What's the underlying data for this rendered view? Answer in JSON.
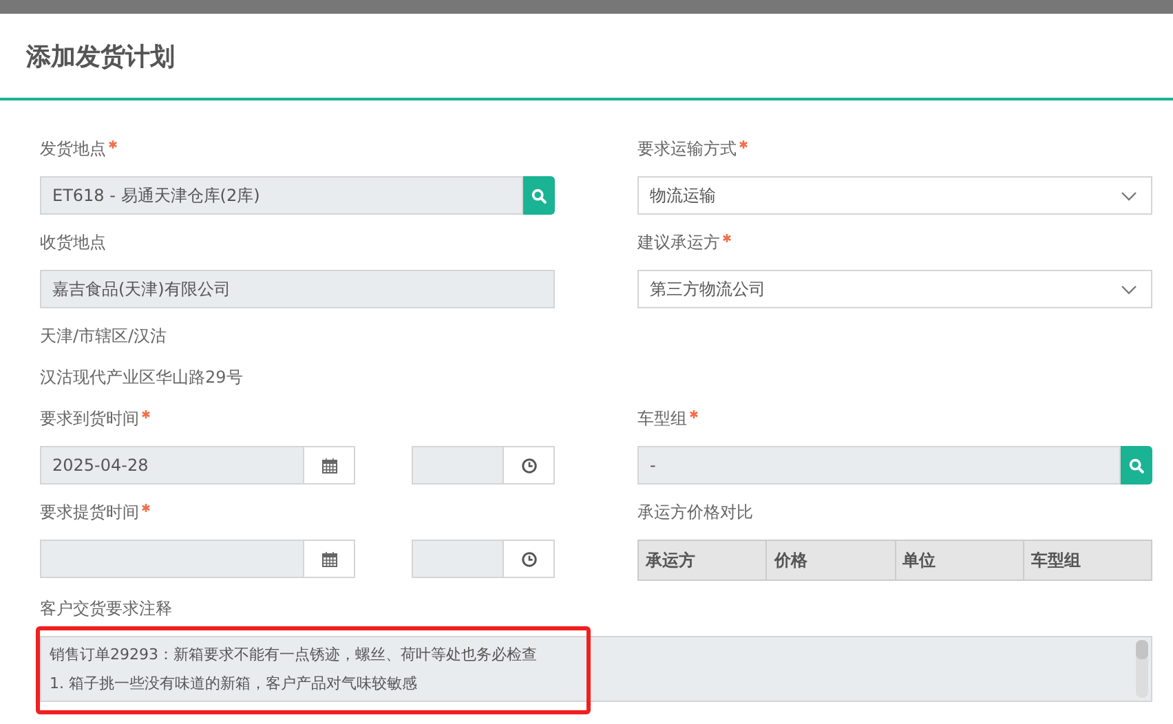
{
  "dialog_title": "添加发货计划",
  "ship_from": {
    "label": "发货地点",
    "required": true,
    "value": "ET618 - 易通天津仓库(2库)"
  },
  "transport_mode": {
    "label": "要求运输方式",
    "required": true,
    "value": "物流运输"
  },
  "receiving_site": {
    "label": "收货地点",
    "required": false,
    "value": "嘉吉食品(天津)有限公司"
  },
  "suggested_carrier": {
    "label": "建议承运方",
    "required": true,
    "value": "第三方物流公司"
  },
  "receiving_address": [
    "天津/市辖区/汉沽",
    "汉沽现代产业区华山路29号"
  ],
  "arrival_time": {
    "label": "要求到货时间",
    "required": true,
    "date": "2025-04-28"
  },
  "vehicle_group": {
    "label": "车型组",
    "required": true,
    "value": "-"
  },
  "pickup_time": {
    "label": "要求提货时间",
    "required": true
  },
  "carrier_price_comparison": {
    "label": "承运方价格对比",
    "columns": [
      "承运方",
      "价格",
      "单位",
      "车型组"
    ]
  },
  "delivery_notes": {
    "label": "客户交货要求注释",
    "highlighted": true,
    "lines": [
      "销售订单29293：新箱要求不能有一点锈迹，螺丝、荷叶等处也务必检查",
      "1. 箱子挑一些没有味道的新箱，客户产品对气味较敏感"
    ]
  }
}
